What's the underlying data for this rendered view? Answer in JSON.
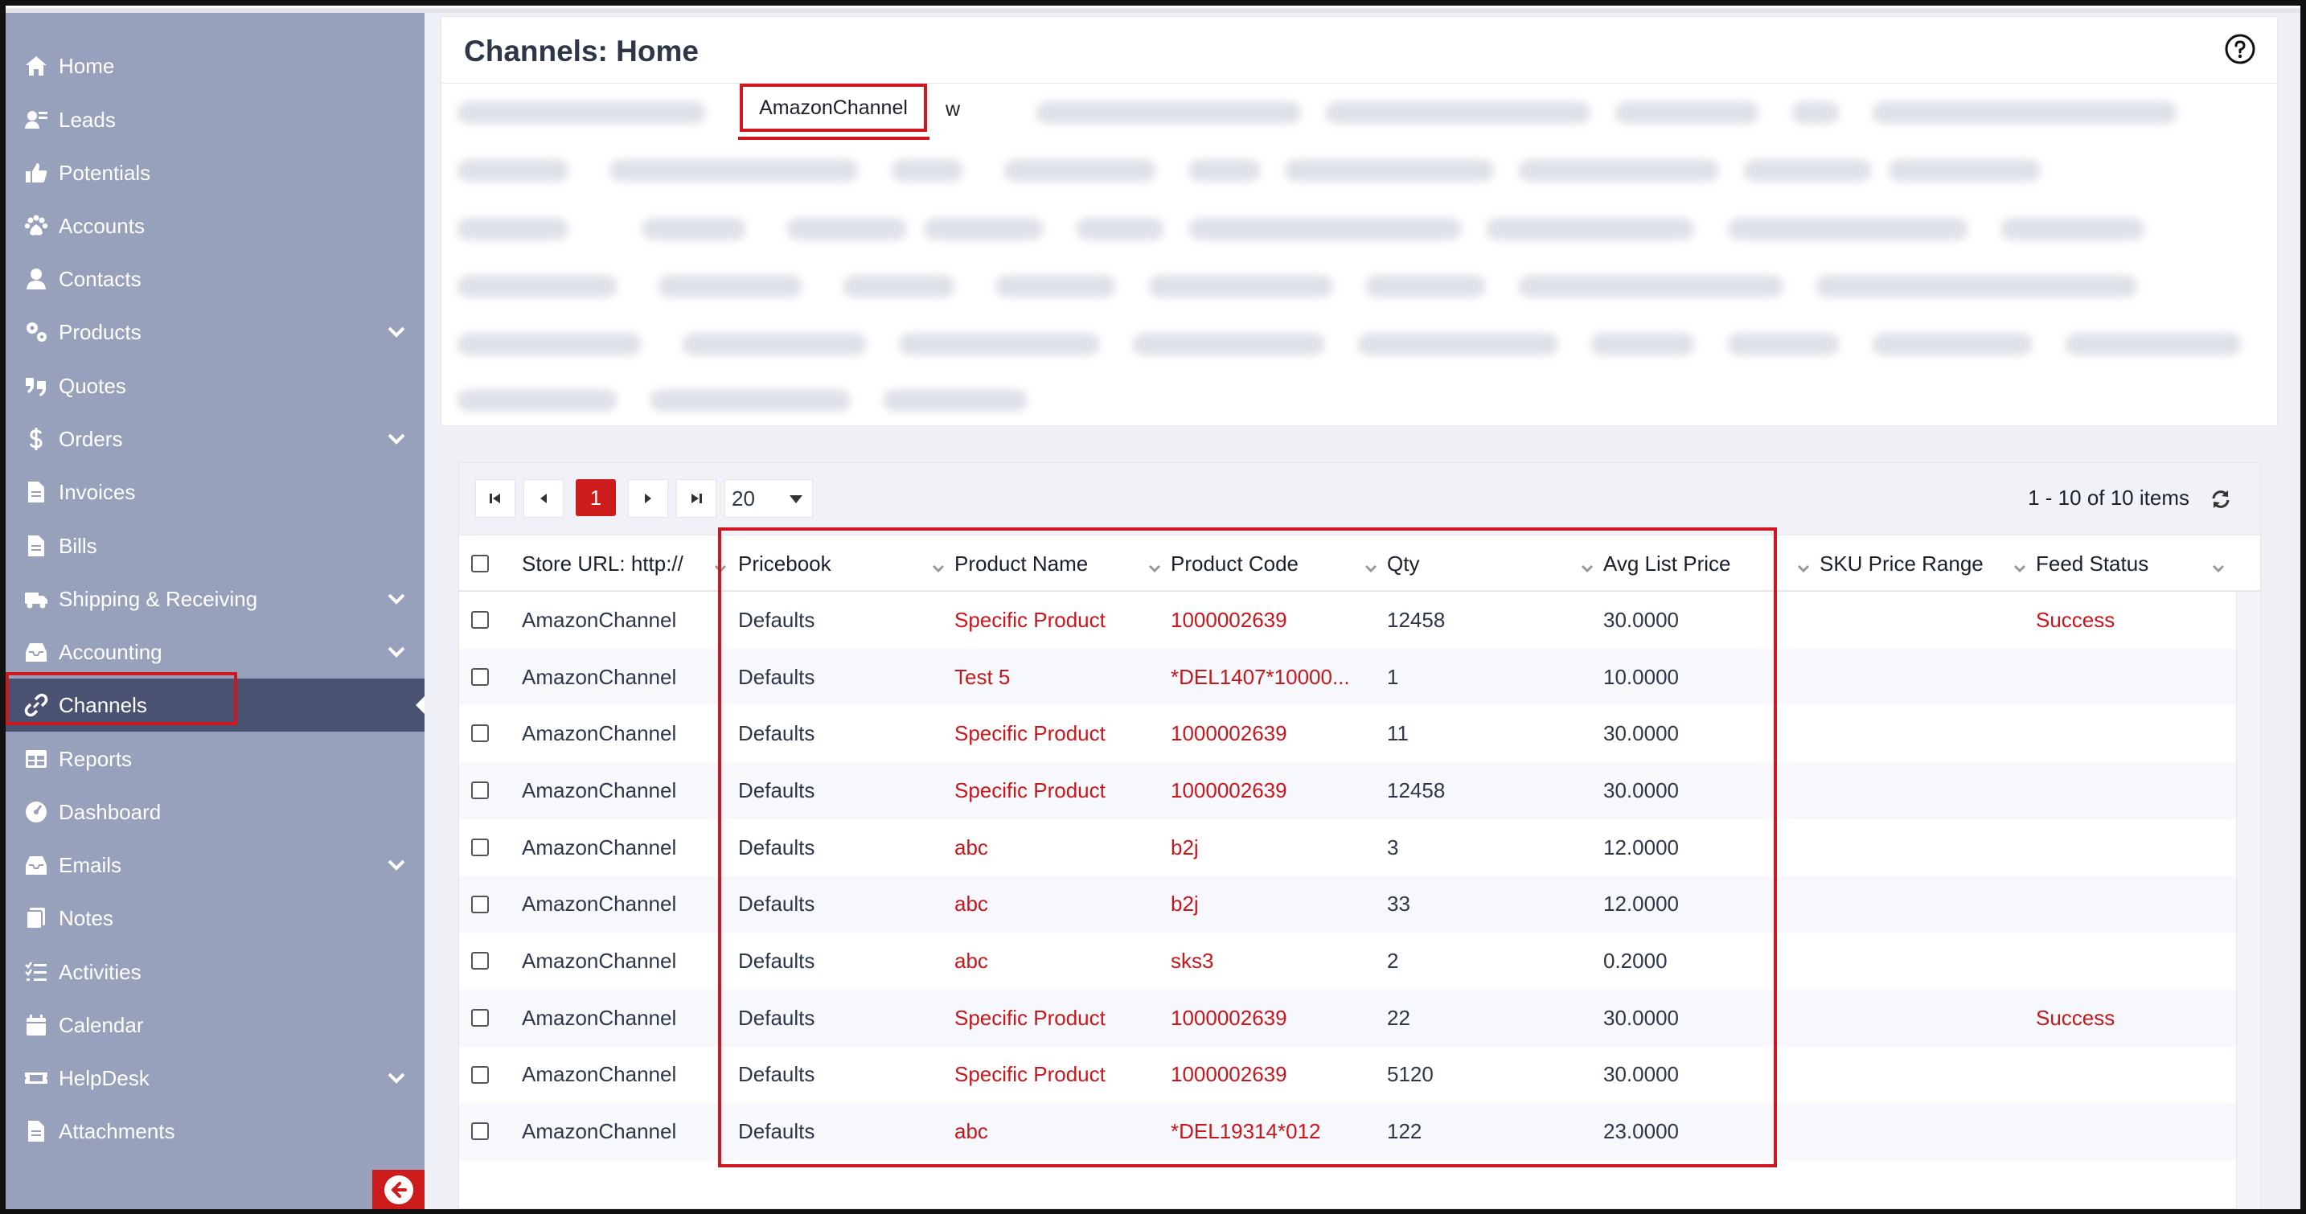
{
  "sidebar": {
    "items": [
      {
        "label": "Home",
        "icon": "home-icon",
        "expandable": false
      },
      {
        "label": "Leads",
        "icon": "leads-icon",
        "expandable": false
      },
      {
        "label": "Potentials",
        "icon": "thumbs-up-icon",
        "expandable": false
      },
      {
        "label": "Accounts",
        "icon": "paw-icon",
        "expandable": false
      },
      {
        "label": "Contacts",
        "icon": "user-icon",
        "expandable": false
      },
      {
        "label": "Products",
        "icon": "gears-icon",
        "expandable": true
      },
      {
        "label": "Quotes",
        "icon": "quote-icon",
        "expandable": false
      },
      {
        "label": "Orders",
        "icon": "dollar-icon",
        "expandable": true
      },
      {
        "label": "Invoices",
        "icon": "file-icon",
        "expandable": false
      },
      {
        "label": "Bills",
        "icon": "file-icon",
        "expandable": false
      },
      {
        "label": "Shipping & Receiving",
        "icon": "truck-icon",
        "expandable": true
      },
      {
        "label": "Accounting",
        "icon": "inbox-icon",
        "expandable": true
      },
      {
        "label": "Channels",
        "icon": "link-icon",
        "expandable": false,
        "active": true
      },
      {
        "label": "Reports",
        "icon": "table-icon",
        "expandable": false
      },
      {
        "label": "Dashboard",
        "icon": "gauge-icon",
        "expandable": false
      },
      {
        "label": "Emails",
        "icon": "inbox-icon",
        "expandable": true
      },
      {
        "label": "Notes",
        "icon": "notes-icon",
        "expandable": false
      },
      {
        "label": "Activities",
        "icon": "list-check-icon",
        "expandable": false
      },
      {
        "label": "Calendar",
        "icon": "calendar-icon",
        "expandable": false
      },
      {
        "label": "HelpDesk",
        "icon": "ticket-icon",
        "expandable": true
      },
      {
        "label": "Attachments",
        "icon": "file-icon",
        "expandable": false
      }
    ]
  },
  "header": {
    "title": "Channels: Home",
    "active_tab": "AmazonChannel",
    "next_tab_fragment": "w"
  },
  "pager": {
    "current_page": "1",
    "page_size": "20",
    "info": "1 - 10 of 10 items"
  },
  "table": {
    "columns": [
      "Store URL: http://",
      "Pricebook",
      "Product Name",
      "Product Code",
      "Qty",
      "Avg List Price",
      "SKU Price Range",
      "Feed Status"
    ],
    "rows": [
      {
        "store": "AmazonChannel",
        "pricebook": "Defaults",
        "product_name": "Specific Product",
        "product_code": "1000002639",
        "qty": "12458",
        "avg_list_price": "30.0000",
        "sku_price_range": "",
        "feed_status": "Success"
      },
      {
        "store": "AmazonChannel",
        "pricebook": "Defaults",
        "product_name": "Test 5",
        "product_code": "*DEL1407*10000...",
        "qty": "1",
        "avg_list_price": "10.0000",
        "sku_price_range": "",
        "feed_status": ""
      },
      {
        "store": "AmazonChannel",
        "pricebook": "Defaults",
        "product_name": "Specific Product",
        "product_code": "1000002639",
        "qty": "11",
        "avg_list_price": "30.0000",
        "sku_price_range": "",
        "feed_status": ""
      },
      {
        "store": "AmazonChannel",
        "pricebook": "Defaults",
        "product_name": "Specific Product",
        "product_code": "1000002639",
        "qty": "12458",
        "avg_list_price": "30.0000",
        "sku_price_range": "",
        "feed_status": ""
      },
      {
        "store": "AmazonChannel",
        "pricebook": "Defaults",
        "product_name": "abc",
        "product_code": "b2j",
        "qty": "3",
        "avg_list_price": "12.0000",
        "sku_price_range": "",
        "feed_status": ""
      },
      {
        "store": "AmazonChannel",
        "pricebook": "Defaults",
        "product_name": "abc",
        "product_code": "b2j",
        "qty": "33",
        "avg_list_price": "12.0000",
        "sku_price_range": "",
        "feed_status": ""
      },
      {
        "store": "AmazonChannel",
        "pricebook": "Defaults",
        "product_name": "abc",
        "product_code": "sks3",
        "qty": "2",
        "avg_list_price": "0.2000",
        "sku_price_range": "",
        "feed_status": ""
      },
      {
        "store": "AmazonChannel",
        "pricebook": "Defaults",
        "product_name": "Specific Product",
        "product_code": "1000002639",
        "qty": "22",
        "avg_list_price": "30.0000",
        "sku_price_range": "",
        "feed_status": "Success"
      },
      {
        "store": "AmazonChannel",
        "pricebook": "Defaults",
        "product_name": "Specific Product",
        "product_code": "1000002639",
        "qty": "5120",
        "avg_list_price": "30.0000",
        "sku_price_range": "",
        "feed_status": ""
      },
      {
        "store": "AmazonChannel",
        "pricebook": "Defaults",
        "product_name": "abc",
        "product_code": "*DEL19314*012",
        "qty": "122",
        "avg_list_price": "23.0000",
        "sku_price_range": "",
        "feed_status": ""
      }
    ]
  },
  "colors": {
    "sidebar_bg": "#98a1bb",
    "sidebar_active": "#4a5271",
    "accent_red": "#cc1c1c",
    "link_red": "#c8161d"
  }
}
